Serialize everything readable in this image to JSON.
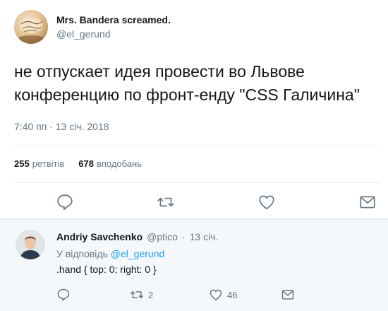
{
  "tweet": {
    "display_name": "Mrs. Bandera screamed.",
    "handle": "@el_gerund",
    "text": "не отпускает идея провести во Львове конференцию по фронт-енду \"CSS Галичина\"",
    "timestamp": "7:40 пп · 13 січ. 2018",
    "retweets_count": "255",
    "retweets_label": "ретвітів",
    "likes_count": "678",
    "likes_label": "вподобань",
    "actions": [
      "reply-icon",
      "retweet-icon",
      "like-icon",
      "message-icon"
    ]
  },
  "reply": {
    "display_name": "Andriy Savchenko",
    "handle": "@ptico",
    "separator": "·",
    "date": "13 січ.",
    "replying_to_prefix": "У відповідь",
    "replying_to_handle": "@el_gerund",
    "text": ".hand { top: 0; right: 0 }",
    "retweets_count": "2",
    "likes_count": "46",
    "actions": [
      "reply-icon",
      "retweet-icon",
      "like-icon",
      "message-icon"
    ]
  },
  "colors": {
    "primary_text": "#14171a",
    "secondary_text": "#657786",
    "link": "#1da1f2",
    "divider": "#e6ecf0",
    "reply_bg": "#f5f8fa"
  }
}
